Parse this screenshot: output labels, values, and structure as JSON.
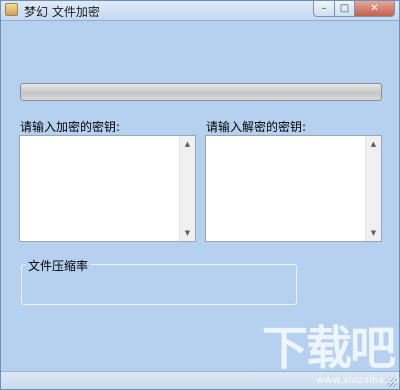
{
  "window": {
    "title": "梦幻 文件加密",
    "controls": {
      "minimize": "–",
      "maximize": "□",
      "close": "✕"
    }
  },
  "progress": {
    "value": 0
  },
  "encrypt": {
    "label": "请输入加密的密钥:",
    "value": ""
  },
  "decrypt": {
    "label": "请输入解密的密钥:",
    "value": ""
  },
  "compression": {
    "legend": "文件压缩率"
  },
  "watermark": {
    "text": "下载吧",
    "url": "www.xiazaiba.com"
  },
  "icons": {
    "app": "app-icon",
    "scroll_up": "▲",
    "scroll_down": "▼"
  }
}
